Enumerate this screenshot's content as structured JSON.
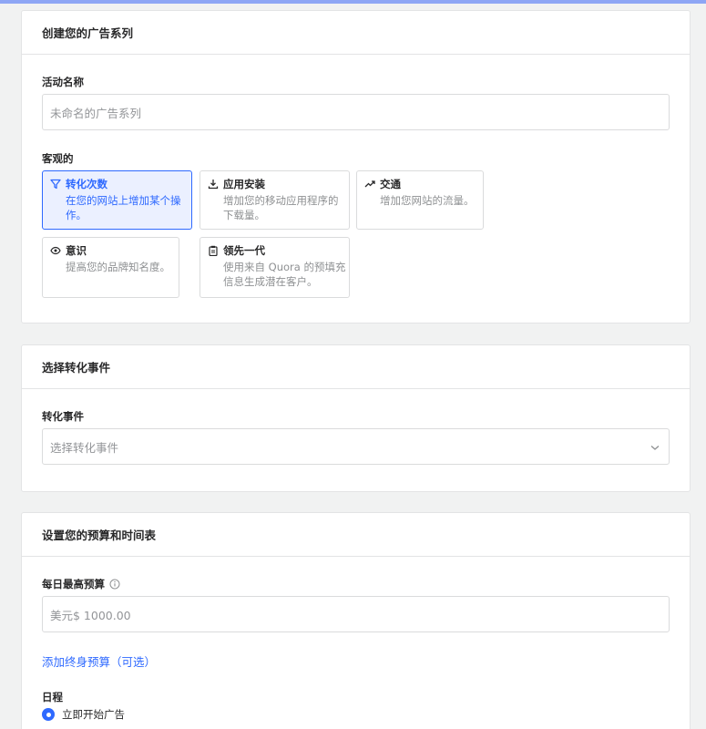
{
  "campaign": {
    "header": "创建您的广告系列",
    "name_label": "活动名称",
    "name_placeholder": "未命名的广告系列",
    "objective_label": "客观的",
    "objectives": [
      {
        "title": "转化次数",
        "desc": "在您的网站上增加某个操作。",
        "icon": "filter-icon",
        "selected": true
      },
      {
        "title": "应用安装",
        "desc": "增加您的移动应用程序的下载量。",
        "icon": "download-icon",
        "selected": false
      },
      {
        "title": "交通",
        "desc": "增加您网站的流量。",
        "icon": "trending-up-icon",
        "selected": false
      },
      {
        "title": "意识",
        "desc": "提高您的品牌知名度。",
        "icon": "eye-icon",
        "selected": false
      },
      {
        "title": "领先一代",
        "desc": "使用来自 Quora 的预填充信息生成潜在客户。",
        "icon": "clipboard-icon",
        "selected": false
      }
    ]
  },
  "conversion": {
    "header": "选择转化事件",
    "event_label": "转化事件",
    "event_placeholder": "选择转化事件"
  },
  "budget": {
    "header": "设置您的预算和时间表",
    "daily_label": "每日最高预算",
    "daily_placeholder": "美元$ 1000.00",
    "lifetime_link": "添加终身预算（可选）",
    "schedule_label": "日程",
    "schedule_option": "立即开始广告"
  },
  "colors": {
    "accent": "#2e69ff",
    "selected_bg": "#ebf0ff",
    "page_bg": "#f1f2f2"
  }
}
